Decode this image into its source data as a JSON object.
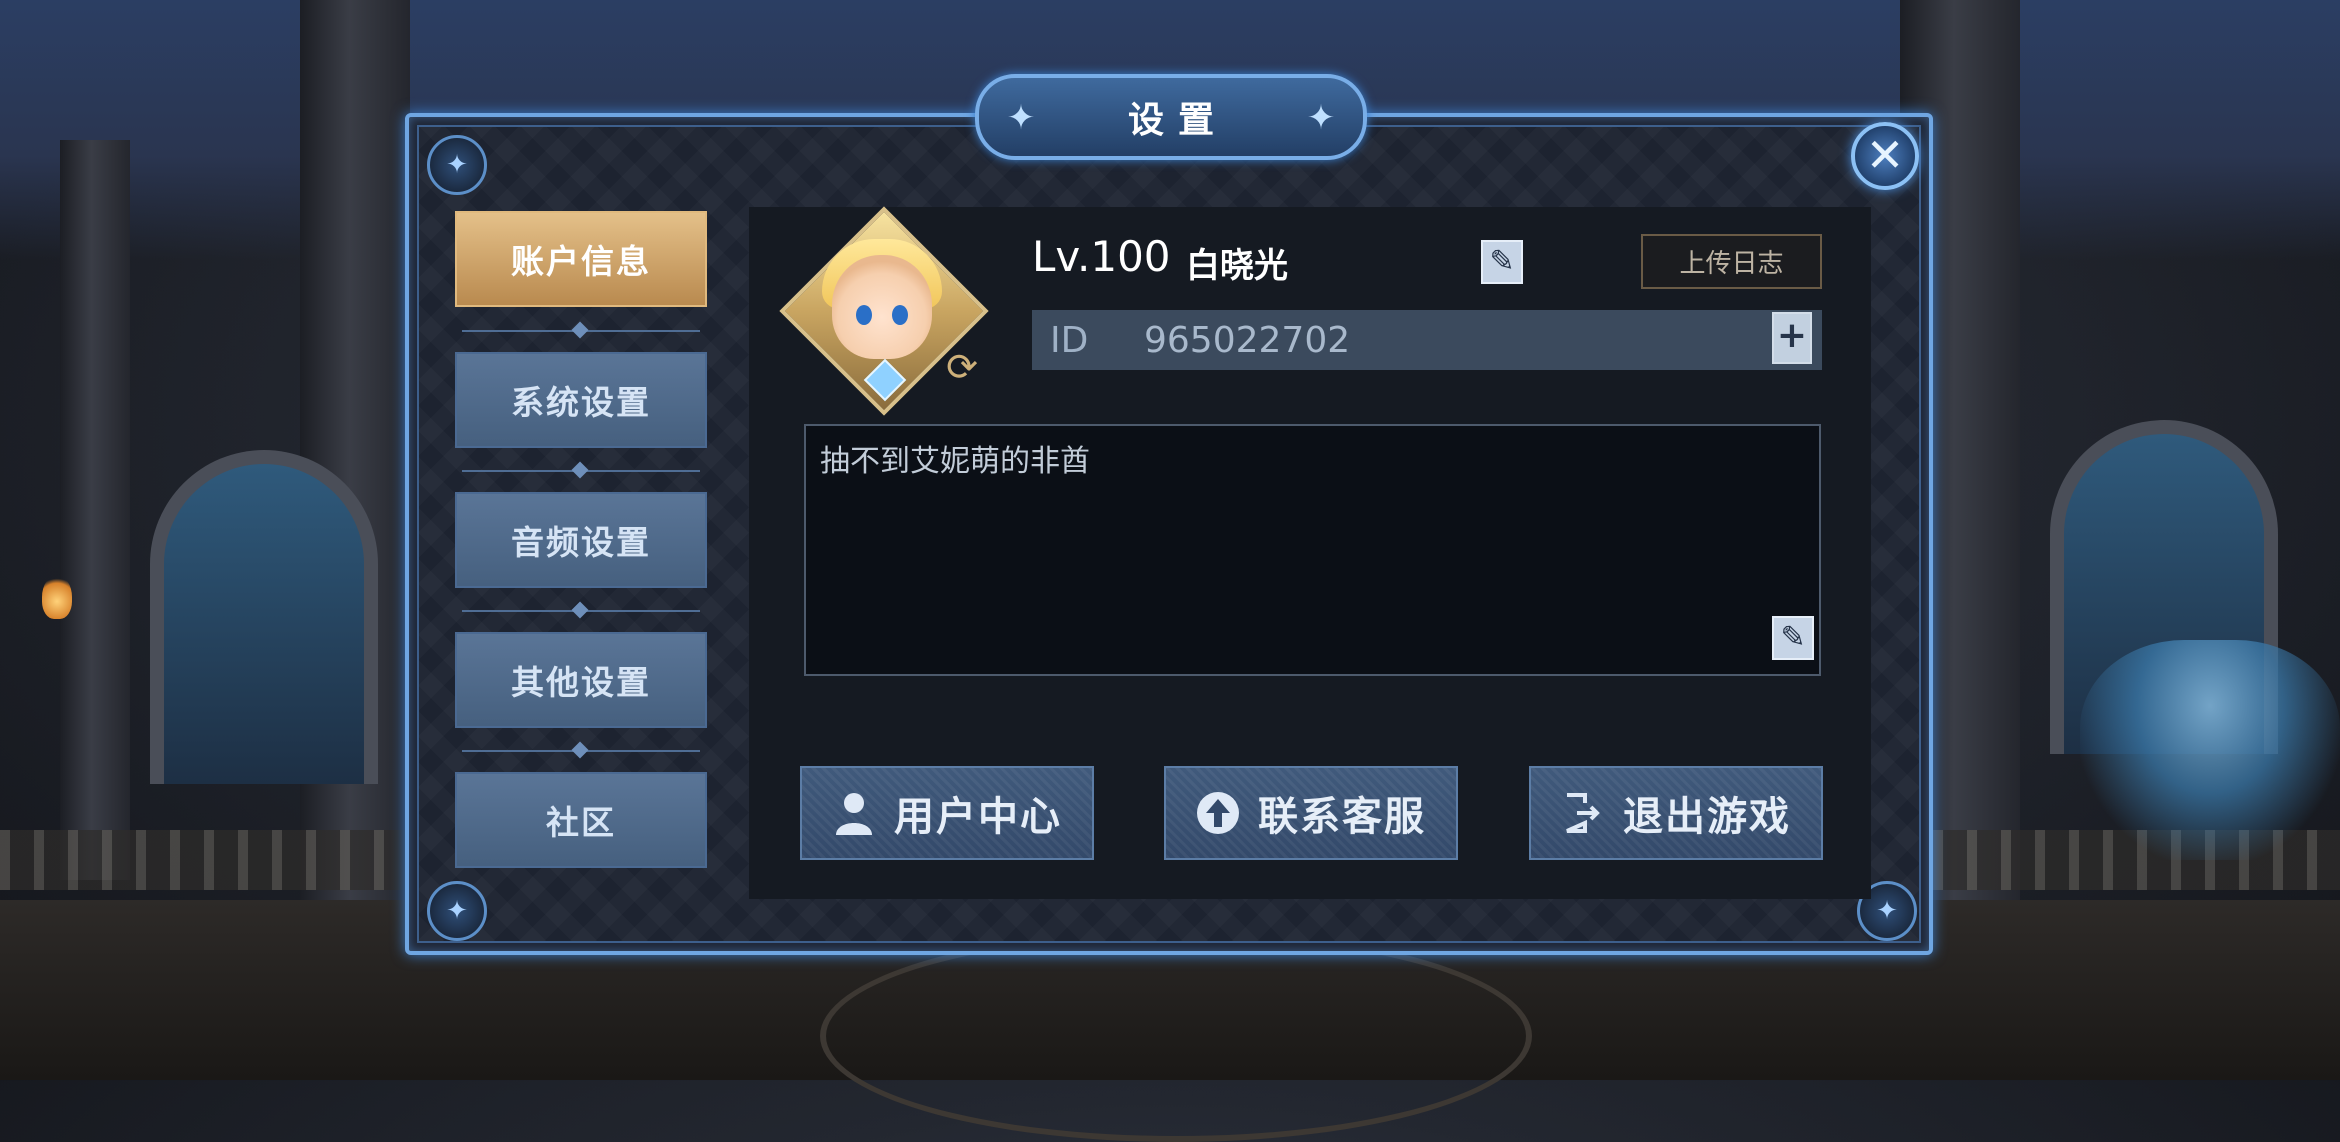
{
  "dialog": {
    "title": "设置"
  },
  "sidebar": {
    "items": [
      {
        "label": "账户信息",
        "active": true
      },
      {
        "label": "系统设置",
        "active": false
      },
      {
        "label": "音频设置",
        "active": false
      },
      {
        "label": "其他设置",
        "active": false
      },
      {
        "label": "社区",
        "active": false
      }
    ]
  },
  "account": {
    "level": "Lv.100",
    "player_name": "白晓光",
    "upload_log_label": "上传日志",
    "id_label": "ID",
    "id_value": "965022702",
    "signature": "抽不到艾妮萌的非酋"
  },
  "actions": {
    "user_center": "用户中心",
    "contact_support": "联系客服",
    "exit_game": "退出游戏"
  },
  "icons": {
    "close": "close-icon",
    "edit": "edit-icon",
    "copy": "copy-icon",
    "refresh": "refresh-icon",
    "user": "user-icon",
    "support": "upload-arrow-icon",
    "exit": "exit-icon"
  },
  "colors": {
    "accent_gold": "#e4c089",
    "accent_blue": "#6fa6e2",
    "button_blue": "#46607f"
  }
}
